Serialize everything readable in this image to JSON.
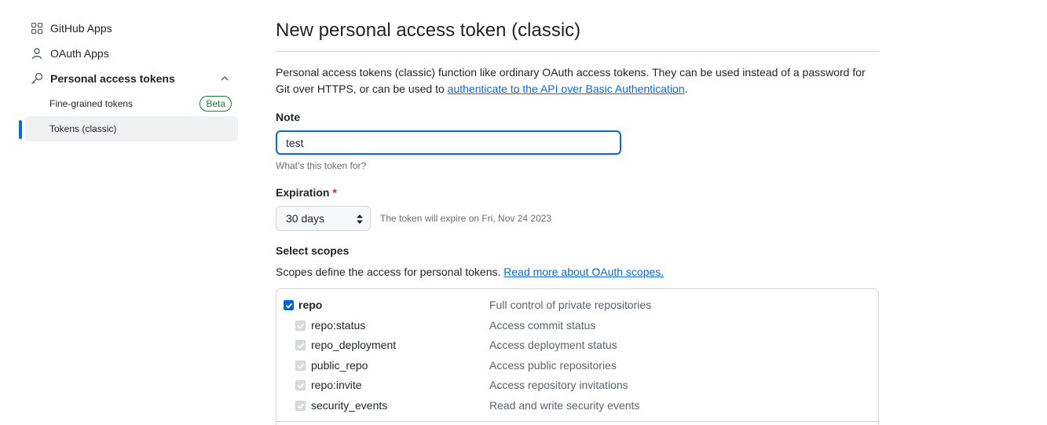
{
  "sidebar": {
    "items": [
      {
        "label": "GitHub Apps",
        "icon": "apps-icon"
      },
      {
        "label": "OAuth Apps",
        "icon": "person-icon"
      },
      {
        "label": "Personal access tokens",
        "icon": "key-icon"
      },
      {
        "label": "Fine-grained tokens",
        "badge": "Beta"
      },
      {
        "label": "Tokens (classic)",
        "active": true
      }
    ]
  },
  "main": {
    "title": "New personal access token (classic)",
    "description_text": "Personal access tokens (classic) function like ordinary OAuth access tokens. They can be used instead of a password for Git over HTTPS, or can be used to ",
    "description_link": "authenticate to the API over Basic Authentication",
    "description_end": ".",
    "note": {
      "label": "Note",
      "value": "test",
      "hint": "What’s this token for?"
    },
    "expiration": {
      "label": "Expiration",
      "required_mark": "*",
      "selected": "30 days",
      "hint": "The token will expire on Fri, Nov 24 2023"
    },
    "scopes": {
      "label": "Select scopes",
      "description": "Scopes define the access for personal tokens. ",
      "link": "Read more about OAuth scopes.",
      "rows": [
        {
          "name": "repo",
          "description": "Full control of private repositories",
          "checked": true,
          "parent": true
        },
        {
          "name": "repo:status",
          "description": "Access commit status",
          "checked": true,
          "disabled": true
        },
        {
          "name": "repo_deployment",
          "description": "Access deployment status",
          "checked": true,
          "disabled": true
        },
        {
          "name": "public_repo",
          "description": "Access public repositories",
          "checked": true,
          "disabled": true
        },
        {
          "name": "repo:invite",
          "description": "Access repository invitations",
          "checked": true,
          "disabled": true
        },
        {
          "name": "security_events",
          "description": "Read and write security events",
          "checked": true,
          "disabled": true
        }
      ]
    }
  },
  "colors": {
    "accent": "#0969da",
    "beta": "#1a7f37",
    "required": "#cf222e"
  }
}
